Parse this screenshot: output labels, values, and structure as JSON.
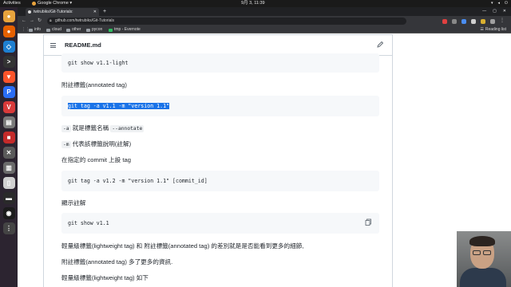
{
  "topbar": {
    "activities": "Activities",
    "app_name": "Google Chrome ▾",
    "clock": "9月 3, 11:39",
    "tray_icons": [
      "network-icon",
      "volume-icon",
      "power-icon"
    ]
  },
  "dock": {
    "apps": [
      {
        "name": "chrome-icon",
        "color": "#e8a33d",
        "glyph": "●"
      },
      {
        "name": "firefox-icon",
        "color": "#e66000",
        "glyph": "●"
      },
      {
        "name": "vscode-icon",
        "color": "#1e7fd1",
        "glyph": "◇"
      },
      {
        "name": "terminal-icon",
        "color": "#333333",
        "glyph": ">"
      },
      {
        "name": "brave-icon",
        "color": "#fb542b",
        "glyph": "▼"
      },
      {
        "name": "pycharm-icon",
        "color": "#2a6df5",
        "glyph": "P"
      },
      {
        "name": "vivaldi-icon",
        "color": "#d83a3a",
        "glyph": "V"
      },
      {
        "name": "files-icon",
        "color": "#7a7a7a",
        "glyph": "▤"
      },
      {
        "name": "app-icon",
        "color": "#c42a2a",
        "glyph": "■"
      },
      {
        "name": "tools-icon",
        "color": "#5a5a5a",
        "glyph": "✕"
      },
      {
        "name": "image-icon",
        "color": "#6a6a6a",
        "glyph": "▥"
      },
      {
        "name": "text-editor-icon",
        "color": "#d0d0d0",
        "glyph": "▯"
      },
      {
        "name": "console-icon",
        "color": "#2a2a2a",
        "glyph": "▬"
      },
      {
        "name": "obs-icon",
        "color": "#1b1b1b",
        "glyph": "◉"
      },
      {
        "name": "show-apps-icon",
        "color": "#444444",
        "glyph": "⋮"
      }
    ]
  },
  "browser": {
    "tab_title": "twtrubiks/Git-Tutorials:",
    "url": "github.com/twtrubiks/Git-Tutorials",
    "bookmarks": [
      "info",
      "cloud",
      "other",
      "pycon",
      "tmp - Evernote"
    ],
    "reading_list": "Reading list",
    "extension_colors": [
      "#e04040",
      "#888888",
      "#4a8df0",
      "#cfcfcf",
      "#d9b030",
      "#a0a0a0"
    ]
  },
  "readme": {
    "title": "README.md",
    "code1": "git show v1.1-light",
    "heading_annotated": "附註標籤(annotated tag)",
    "code2": "git tag -a v1.1 -m \"version 1.1\"",
    "line_a_code": "-a",
    "line_a_text": " 就是標籤名稱 ",
    "line_a_code2": "--annotate",
    "line_m_code": "-m",
    "line_m_text": " 代表該標籤說明(註解)",
    "commit_text": "在指定的 commit 上設 tag",
    "code3": "git tag -a v1.2 -m \"version 1.1\" [commit_id]",
    "show_note": "顯示註解",
    "code4": "git show v1.1",
    "diff_text": "輕量級標籤(lightweight tag) 和 附註標籤(annotated tag) 的差別就是是否能看到更多的細節,",
    "more_info": "附註標籤(annotated tag) 多了更多的資訊.",
    "lightweight_below": "輕量級標籤(lightweight tag) 如下"
  }
}
